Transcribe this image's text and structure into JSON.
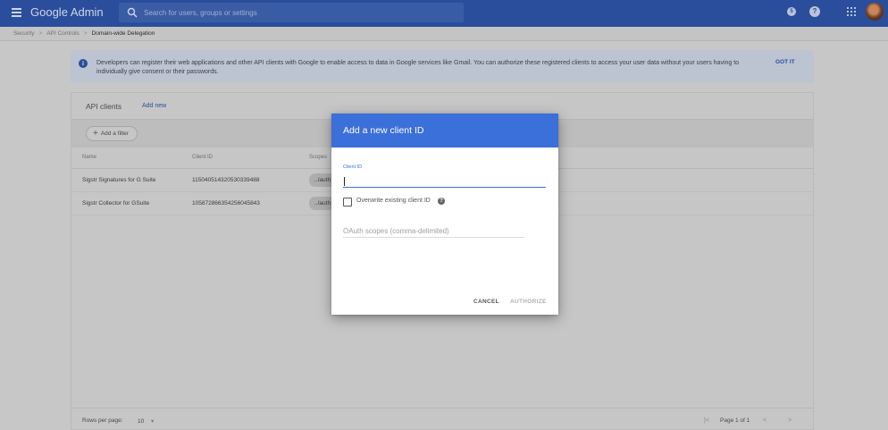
{
  "topbar": {
    "brand": "Google Admin",
    "search_placeholder": "Search for users, groups or settings",
    "notification_count": "5",
    "help_symbol": "?",
    "icons": [
      "menu-icon",
      "search-icon",
      "notifications-icon",
      "help-icon",
      "apps-grid-icon",
      "avatar"
    ],
    "color": "#2a4e9b"
  },
  "breadcrumb": {
    "items": [
      "Security",
      "API Controls",
      "Domain-wide Delegation"
    ],
    "separator": ">"
  },
  "banner": {
    "text": "Developers can register their web applications and other API clients with Google to enable access to data in Google services like Gmail. You can authorize these registered clients to access your user data without your users having to individually give consent or their passwords.",
    "dismiss_label": "GOT IT",
    "info_symbol": "i"
  },
  "clients_card": {
    "title": "API clients",
    "add_new_label": "Add new",
    "filter_label": "Add a filter",
    "filter_plus": "+",
    "columns": [
      "Name",
      "Client ID",
      "Scopes"
    ],
    "rows": [
      {
        "name": "Sigstr Signatures for G Suite",
        "client_id": "115040514320530339488",
        "scopes": "../auth"
      },
      {
        "name": "Sigstr Collector for GSuite",
        "client_id": "105872866354256045843",
        "scopes": "../auth"
      }
    ],
    "footer": {
      "rows_per_page_label": "Rows per page:",
      "rows_per_page_value": "10",
      "dropdown_symbol": "▾",
      "first_page_symbol": "|<",
      "page_info": "Page 1 of 1",
      "prev_symbol": "<",
      "next_symbol": ">"
    }
  },
  "dialog": {
    "title": "Add a new client ID",
    "client_id_label": "Client ID",
    "client_id_value": "",
    "overwrite_label": "Overwrite existing client ID",
    "overwrite_checked": false,
    "help_symbol": "?",
    "scopes_placeholder": "OAuth scopes (comma-delimited)",
    "cancel_label": "CANCEL",
    "authorize_label": "AUTHORIZE",
    "header_color": "#3b6fd9"
  }
}
